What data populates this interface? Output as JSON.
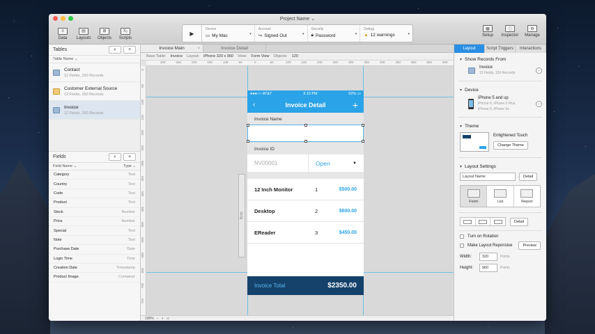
{
  "window": {
    "title": "Project Name ⌄"
  },
  "toolbar": {
    "left": [
      {
        "label": "Data",
        "icon": "database-icon",
        "glyph": "≡"
      },
      {
        "label": "Layouts",
        "icon": "layouts-icon",
        "glyph": "▤"
      },
      {
        "label": "Objects",
        "icon": "objects-icon",
        "glyph": "⊞"
      },
      {
        "label": "Scripts",
        "icon": "scripts-icon",
        "glyph": "X₂"
      }
    ],
    "status": {
      "play_glyph": "▶",
      "device": {
        "label": "Device",
        "value": "My Mac"
      },
      "account": {
        "label": "Account",
        "value": "Signed Out"
      },
      "security": {
        "label": "Security",
        "value": "Password"
      },
      "debug": {
        "label": "Debug",
        "value": "12 warnings"
      }
    },
    "right": [
      {
        "label": "Setup",
        "icon": "setup-icon",
        "glyph": "▦"
      },
      {
        "label": "Inspector",
        "icon": "inspector-icon",
        "glyph": "ⓘ"
      },
      {
        "label": "Manage",
        "icon": "manage-icon",
        "glyph": "⚙"
      }
    ]
  },
  "tables_pane": {
    "title": "Tables",
    "sort_label": "Table Name ⌄",
    "items": [
      {
        "name": "Contact",
        "sub": "12 Fields, 150 Records",
        "selected": false
      },
      {
        "name": "Customer External Source",
        "sub": "12 Fields, 150 Records",
        "selected": false
      },
      {
        "name": "Invoice",
        "sub": "12 Fields, 150 Records",
        "selected": true
      }
    ]
  },
  "fields_pane": {
    "title": "Fields",
    "sort_name": "Field Name ⌄",
    "sort_type": "Type ⌄",
    "items": [
      {
        "name": "Category",
        "type": "Text"
      },
      {
        "name": "Country",
        "type": "Text"
      },
      {
        "name": "Code",
        "type": "Text"
      },
      {
        "name": "Product",
        "type": "Text"
      },
      {
        "name": "Stock",
        "type": "Number"
      },
      {
        "name": "Price",
        "type": "Number"
      },
      {
        "name": "Special",
        "type": "Text"
      },
      {
        "name": "Note",
        "type": "Text"
      },
      {
        "name": "Purchase Date",
        "type": "Date"
      },
      {
        "name": "Login Time",
        "type": "Time"
      },
      {
        "name": "Creation Date",
        "type": "Timestamp"
      },
      {
        "name": "Product Image",
        "type": "Container"
      }
    ]
  },
  "editor": {
    "tabs": [
      "Invoice Main",
      "Invoice Detail"
    ],
    "layoutbar": {
      "base_table_label": "Base Table:",
      "base_table": "Invoice",
      "layout_label": "Layout:",
      "layout": "iPhone  320 x 960",
      "view_label": "View:",
      "view": "Form View",
      "objects_label": "Objects:",
      "objects": "120"
    },
    "ruler_h": [
      "300",
      "250",
      "200",
      "150",
      "100",
      "50",
      "0",
      "50",
      "100",
      "150",
      "200",
      "250",
      "300",
      "350",
      "400",
      "450",
      "500",
      "550",
      "600"
    ],
    "ruler_v": [
      "0",
      "50",
      "100",
      "150",
      "200",
      "250",
      "300",
      "350",
      "400",
      "450",
      "500",
      "550",
      "600",
      "650",
      "700",
      "750"
    ],
    "body_part_label": "Body",
    "zoom": "100%"
  },
  "phone": {
    "carrier": "●●●○○ AT&T",
    "time": "3:10 PM",
    "battery": "62% ▭",
    "nav_title": "Invoice Detail",
    "back_glyph": "‹",
    "plus_glyph": "+",
    "name_label": "Invoice Name",
    "id_label": "Invoice ID",
    "id_value": "NV00001",
    "status_value": "Open",
    "status_caret": "▼",
    "items": [
      {
        "name": "12 Inch Monitor",
        "qty": "1",
        "price": "$500.00"
      },
      {
        "name": "Desktop",
        "qty": "2",
        "price": "$600.00"
      },
      {
        "name": "EReader",
        "qty": "3",
        "price": "$450.00"
      }
    ],
    "total_label": "Invoice Total",
    "total_value": "$2350.00"
  },
  "inspector": {
    "tabs": [
      "Layout",
      "Script Triggers",
      "Interactions"
    ],
    "show_records_title": "Show Records From",
    "show_records_name": "Invoice",
    "show_records_sub": "12 Fields, 150 Records",
    "device_title": "Device",
    "device_name": "iPhone 5 and up",
    "device_sub1": "iPhone 6, iPhone 6 Plus",
    "device_sub2": "iPhone 5, iPhone 5s",
    "theme_title": "Theme",
    "theme_name": "Enlightened Touch",
    "change_theme": "Change Theme",
    "settings_title": "Layout Settings",
    "layout_name_placeholder": "Layout Name",
    "detail_btn": "Detail",
    "views": [
      "Form",
      "List",
      "Report"
    ],
    "rotation_label": "Turn on Rotation",
    "responsive_label": "Make Layout Reponsive",
    "preview_btn": "Preview",
    "width_label": "Width:",
    "width_value": "320",
    "width_unit": "Points",
    "height_label": "Height:",
    "height_value": "960",
    "height_unit": "Points"
  }
}
